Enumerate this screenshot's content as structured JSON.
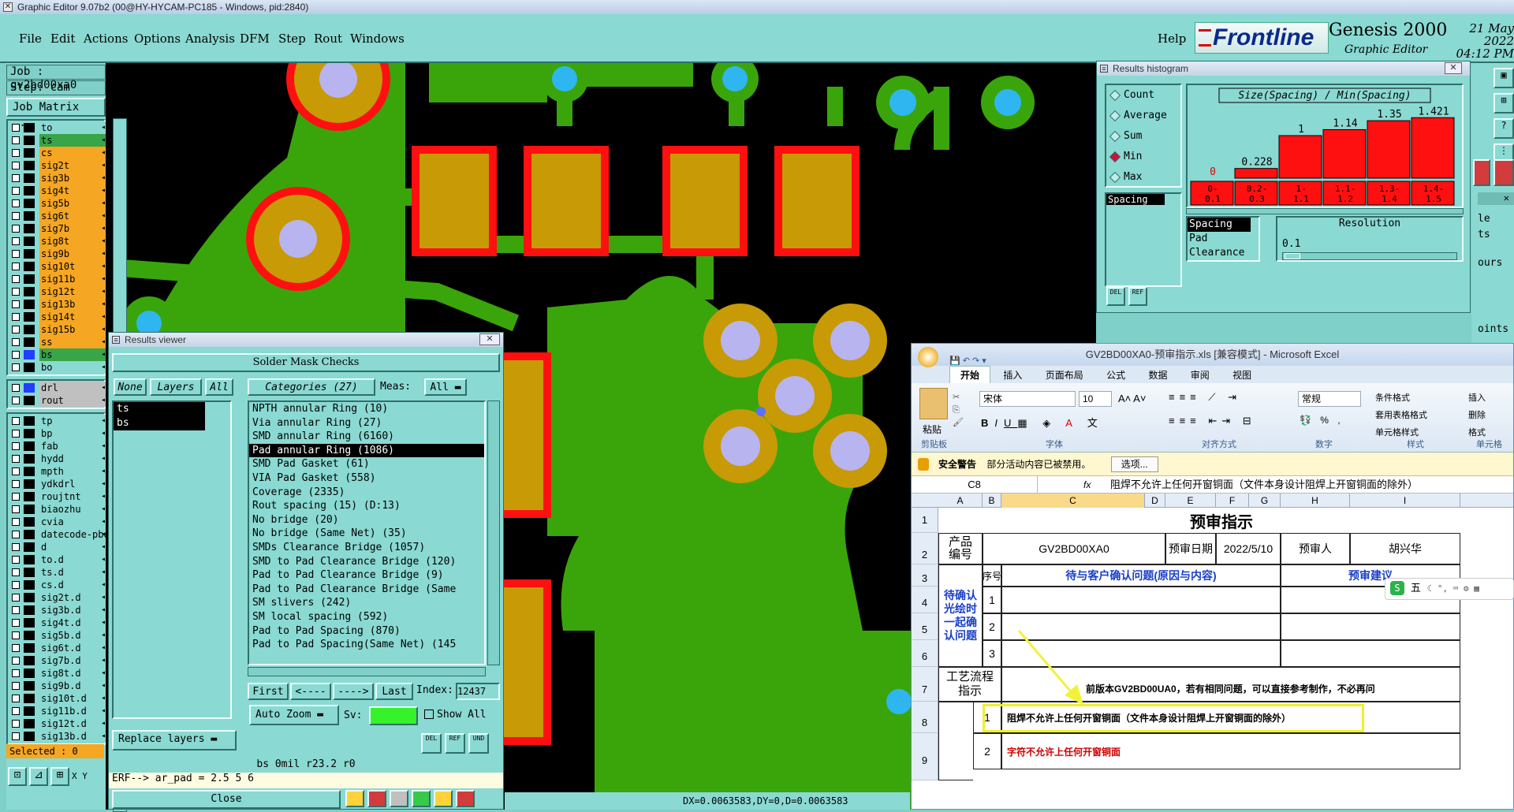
{
  "app_title": "Graphic Editor 9.07b2 (00@HY-HYCAM-PC185 - Windows, pid:2840)",
  "menu": [
    "File",
    "Edit",
    "Actions",
    "Options",
    "Analysis",
    "DFM",
    "Step",
    "Rout",
    "Windows"
  ],
  "help": "Help",
  "brand": {
    "logo": "Frontline",
    "product": "Genesis 2000",
    "subtitle": "Graphic Editor",
    "date": "21 May 2022",
    "time": "04:12 PM"
  },
  "job": {
    "job": "Job : gv2bd00xa0",
    "step": "Step: cam",
    "matrix_button": "Job Matrix ..."
  },
  "layers": [
    {
      "name": "to",
      "state": "none"
    },
    {
      "name": "ts",
      "state": "g"
    },
    {
      "name": "cs",
      "state": "on"
    },
    {
      "name": "sig2t",
      "state": "on"
    },
    {
      "name": "sig3b",
      "state": "on"
    },
    {
      "name": "sig4t",
      "state": "on"
    },
    {
      "name": "sig5b",
      "state": "on"
    },
    {
      "name": "sig6t",
      "state": "on"
    },
    {
      "name": "sig7b",
      "state": "on"
    },
    {
      "name": "sig8t",
      "state": "on"
    },
    {
      "name": "sig9b",
      "state": "on"
    },
    {
      "name": "sig10t",
      "state": "on"
    },
    {
      "name": "sig11b",
      "state": "on"
    },
    {
      "name": "sig12t",
      "state": "on"
    },
    {
      "name": "sig13b",
      "state": "on"
    },
    {
      "name": "sig14t",
      "state": "on"
    },
    {
      "name": "sig15b",
      "state": "on"
    },
    {
      "name": "ss",
      "state": "on"
    },
    {
      "name": "bs",
      "state": "g"
    },
    {
      "name": "bo",
      "state": "none"
    }
  ],
  "layers2": [
    {
      "name": "drl",
      "state": "grey"
    },
    {
      "name": "rout",
      "state": "grey"
    }
  ],
  "layers3": [
    "tp",
    "bp",
    "fab",
    "hydd",
    "mpth",
    "ydkdrl",
    "roujtnt",
    "biaozhu",
    "cvia",
    "datecode-pbe",
    "d",
    "to.d",
    "ts.d",
    "cs.d",
    "sig2t.d",
    "sig3b.d",
    "sig4t.d",
    "sig5b.d",
    "sig6t.d",
    "sig7b.d",
    "sig8t.d",
    "sig9b.d",
    "sig10t.d",
    "sig11b.d",
    "sig12t.d",
    "sig13b.d"
  ],
  "selected": "Selected : 0",
  "results_viewer": {
    "title": "Results viewer",
    "header": "Solder Mask Checks",
    "none": "None",
    "layers_btn": "Layers",
    "all": "All",
    "layer_list": [
      "ts",
      "bs"
    ],
    "categories_btn": "Categories (27)",
    "meas_label": "Meas:",
    "meas_value": "All",
    "categories": [
      "NPTH annular Ring (10)",
      "Via annular Ring (27)",
      "SMD annular Ring (6160)",
      "Pad annular Ring (1086)",
      "SMD Pad Gasket (61)",
      "VIA Pad Gasket (558)",
      "Coverage (2335)",
      "Rout spacing (15)          (D:13)",
      "No bridge (20)",
      "No bridge (Same Net) (35)",
      "SMDs Clearance Bridge (1057)",
      "SMD to Pad Clearance Bridge (120)",
      "Pad to Pad Clearance Bridge (9)",
      "Pad to Pad Clearance Bridge (Same",
      "SM slivers (242)",
      "SM local spacing (592)",
      "Pad to Pad Spacing (870)",
      "Pad to Pad Spacing(Same Net) (145"
    ],
    "selected_index": 3,
    "first": "First",
    "prev": "<----",
    "next": "---->",
    "last": "Last",
    "index_label": "Index:",
    "index_value": "12437",
    "auto_zoom": "Auto Zoom",
    "sv": "Sv:",
    "show_all": "Show All",
    "replace_layers": "Replace layers",
    "status": "bs 0mil   r23.2   r0",
    "erf": "ERF--> ar_pad = 2.5 5 6",
    "close": "Close"
  },
  "histogram": {
    "title": "Results histogram",
    "modes": [
      "Count",
      "Average",
      "Sum",
      "Min",
      "Max"
    ],
    "mode_selected": "Min",
    "chart_title": "Size(Spacing) / Min(Spacing)",
    "list_label": "Spacing",
    "meas_list": [
      "Spacing",
      "Pad",
      "Clearance"
    ],
    "resolution_label": "Resolution",
    "resolution_value": "0.1"
  },
  "chart_data": {
    "type": "bar",
    "title": "Size(Spacing) / Min(Spacing)",
    "categories": [
      "0-\n0.1",
      "0.2-\n0.3",
      "1-\n1.1",
      "1.1-\n1.2",
      "1.3-\n1.4",
      "1.4-\n1.5"
    ],
    "values": [
      0,
      0.228,
      1,
      1.14,
      1.35,
      1.421
    ],
    "labels": [
      "0",
      "0.228",
      "1",
      "1.14",
      "1.35",
      "1.421"
    ]
  },
  "right_strip": [
    "le",
    "ts",
    "ours",
    "oints"
  ],
  "excel": {
    "title": "GV2BD00XA0-预审指示.xls [兼容模式] - Microsoft Excel",
    "tabs": [
      "开始",
      "插入",
      "页面布局",
      "公式",
      "数据",
      "审阅",
      "视图"
    ],
    "font": "宋体",
    "size": "10",
    "number_format": "常规",
    "groups": [
      "剪贴板",
      "字体",
      "对齐方式",
      "数字",
      "样式",
      "单元格"
    ],
    "paste": "粘贴",
    "styles": [
      "条件格式",
      "套用表格格式",
      "单元格样式"
    ],
    "cells_btns": [
      "插入",
      "删除",
      "格式"
    ],
    "security": "安全警告",
    "security_msg": "部分活动内容已被禁用。",
    "options": "选项...",
    "namebox": "C8",
    "formula": "阻焊不允许上任何开窗铜面（文件本身设计阻焊上开窗铜面的除外）",
    "columns": [
      "A",
      "B",
      "C",
      "D",
      "E",
      "F",
      "G",
      "H",
      "I"
    ],
    "rows": [
      "1",
      "2",
      "3",
      "4",
      "5",
      "6",
      "7",
      "8",
      "9"
    ],
    "sheet_title": "预审指示",
    "product_no_label": "产品\n编号",
    "product_no": "GV2BD00XA0",
    "review_date_label": "预审日期",
    "review_date": "2022/5/10",
    "reviewer_label": "预审人",
    "reviewer": "胡兴华",
    "seq_label": "序号",
    "issue_label": "待与客户确认问题(原因与内容)",
    "advice_label": "预审建议",
    "pending_label": "待确认\n光绘时\n一起确\n认问题",
    "seq": [
      "1",
      "2",
      "3"
    ],
    "process_label": "工艺流程\n指示",
    "note": "前版本GV2BD00UA0，若有相同问题，可以直接参考制作，不必再问",
    "item1": "阻焊不允许上任何开窗铜面（文件本身设计阻焊上开窗铜面的除外）",
    "item2": "字符不允许上任何开窗铜面",
    "seq8": "1",
    "seq9": "2"
  },
  "ime": "五",
  "coords": "DX=0.0063583,DY=0,D=0.0063583",
  "colors": {
    "copper": "#c79a06",
    "mask": "#ff1010",
    "ground": "#3aa50a",
    "pad": "#b8b4f0",
    "via": "#2fb6f0"
  }
}
